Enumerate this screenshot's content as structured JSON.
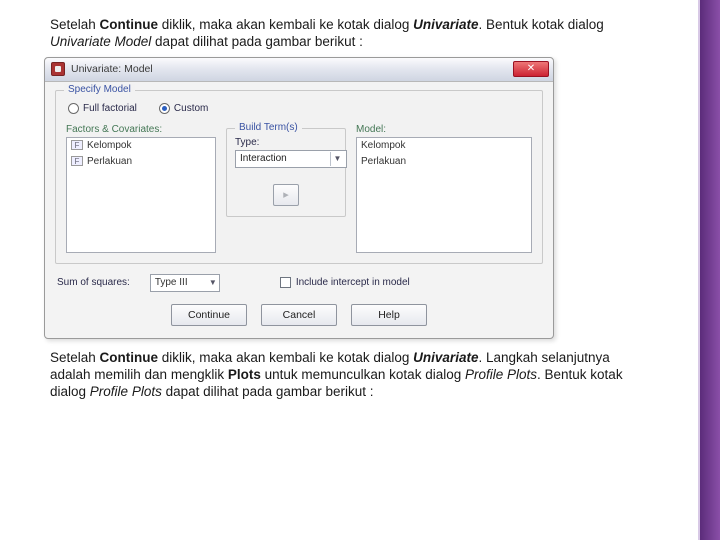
{
  "para1_a": "Setelah ",
  "para1_b": "Continue",
  "para1_c": " diklik, maka akan kembali ke kotak dialog ",
  "para1_d": "Univariate",
  "para1_e": ". Bentuk kotak dialog ",
  "para1_f": "Univariate Model",
  "para1_g": " dapat dilihat pada gambar berikut :",
  "dlg": {
    "title": "Univariate: Model",
    "specify_legend": "Specify Model",
    "radio_full": "Full factorial",
    "radio_custom": "Custom",
    "factors_label": "Factors & Covariates:",
    "factors": [
      "Kelompok",
      "Perlakuan"
    ],
    "model_label": "Model:",
    "model": [
      "Kelompok",
      "Perlakuan"
    ],
    "build_legend": "Build Term(s)",
    "type_label": "Type:",
    "type_value": "Interaction",
    "sum_label": "Sum of squares:",
    "sum_value": "Type III",
    "intercept": "Include intercept in model",
    "btn_continue": "Continue",
    "btn_cancel": "Cancel",
    "btn_help": "Help"
  },
  "para2_a": "Setelah ",
  "para2_b": "Continue",
  "para2_c": " diklik, maka akan kembali ke kotak dialog ",
  "para2_d": "Univariate",
  "para2_e": ". Langkah selanjutnya adalah memilih dan mengklik ",
  "para2_f": "Plots",
  "para2_g": " untuk memunculkan kotak dialog ",
  "para2_h": "Profile Plots",
  "para2_i": ". Bentuk kotak dialog ",
  "para2_j": "Profile Plots",
  "para2_k": " dapat dilihat pada gambar berikut :"
}
